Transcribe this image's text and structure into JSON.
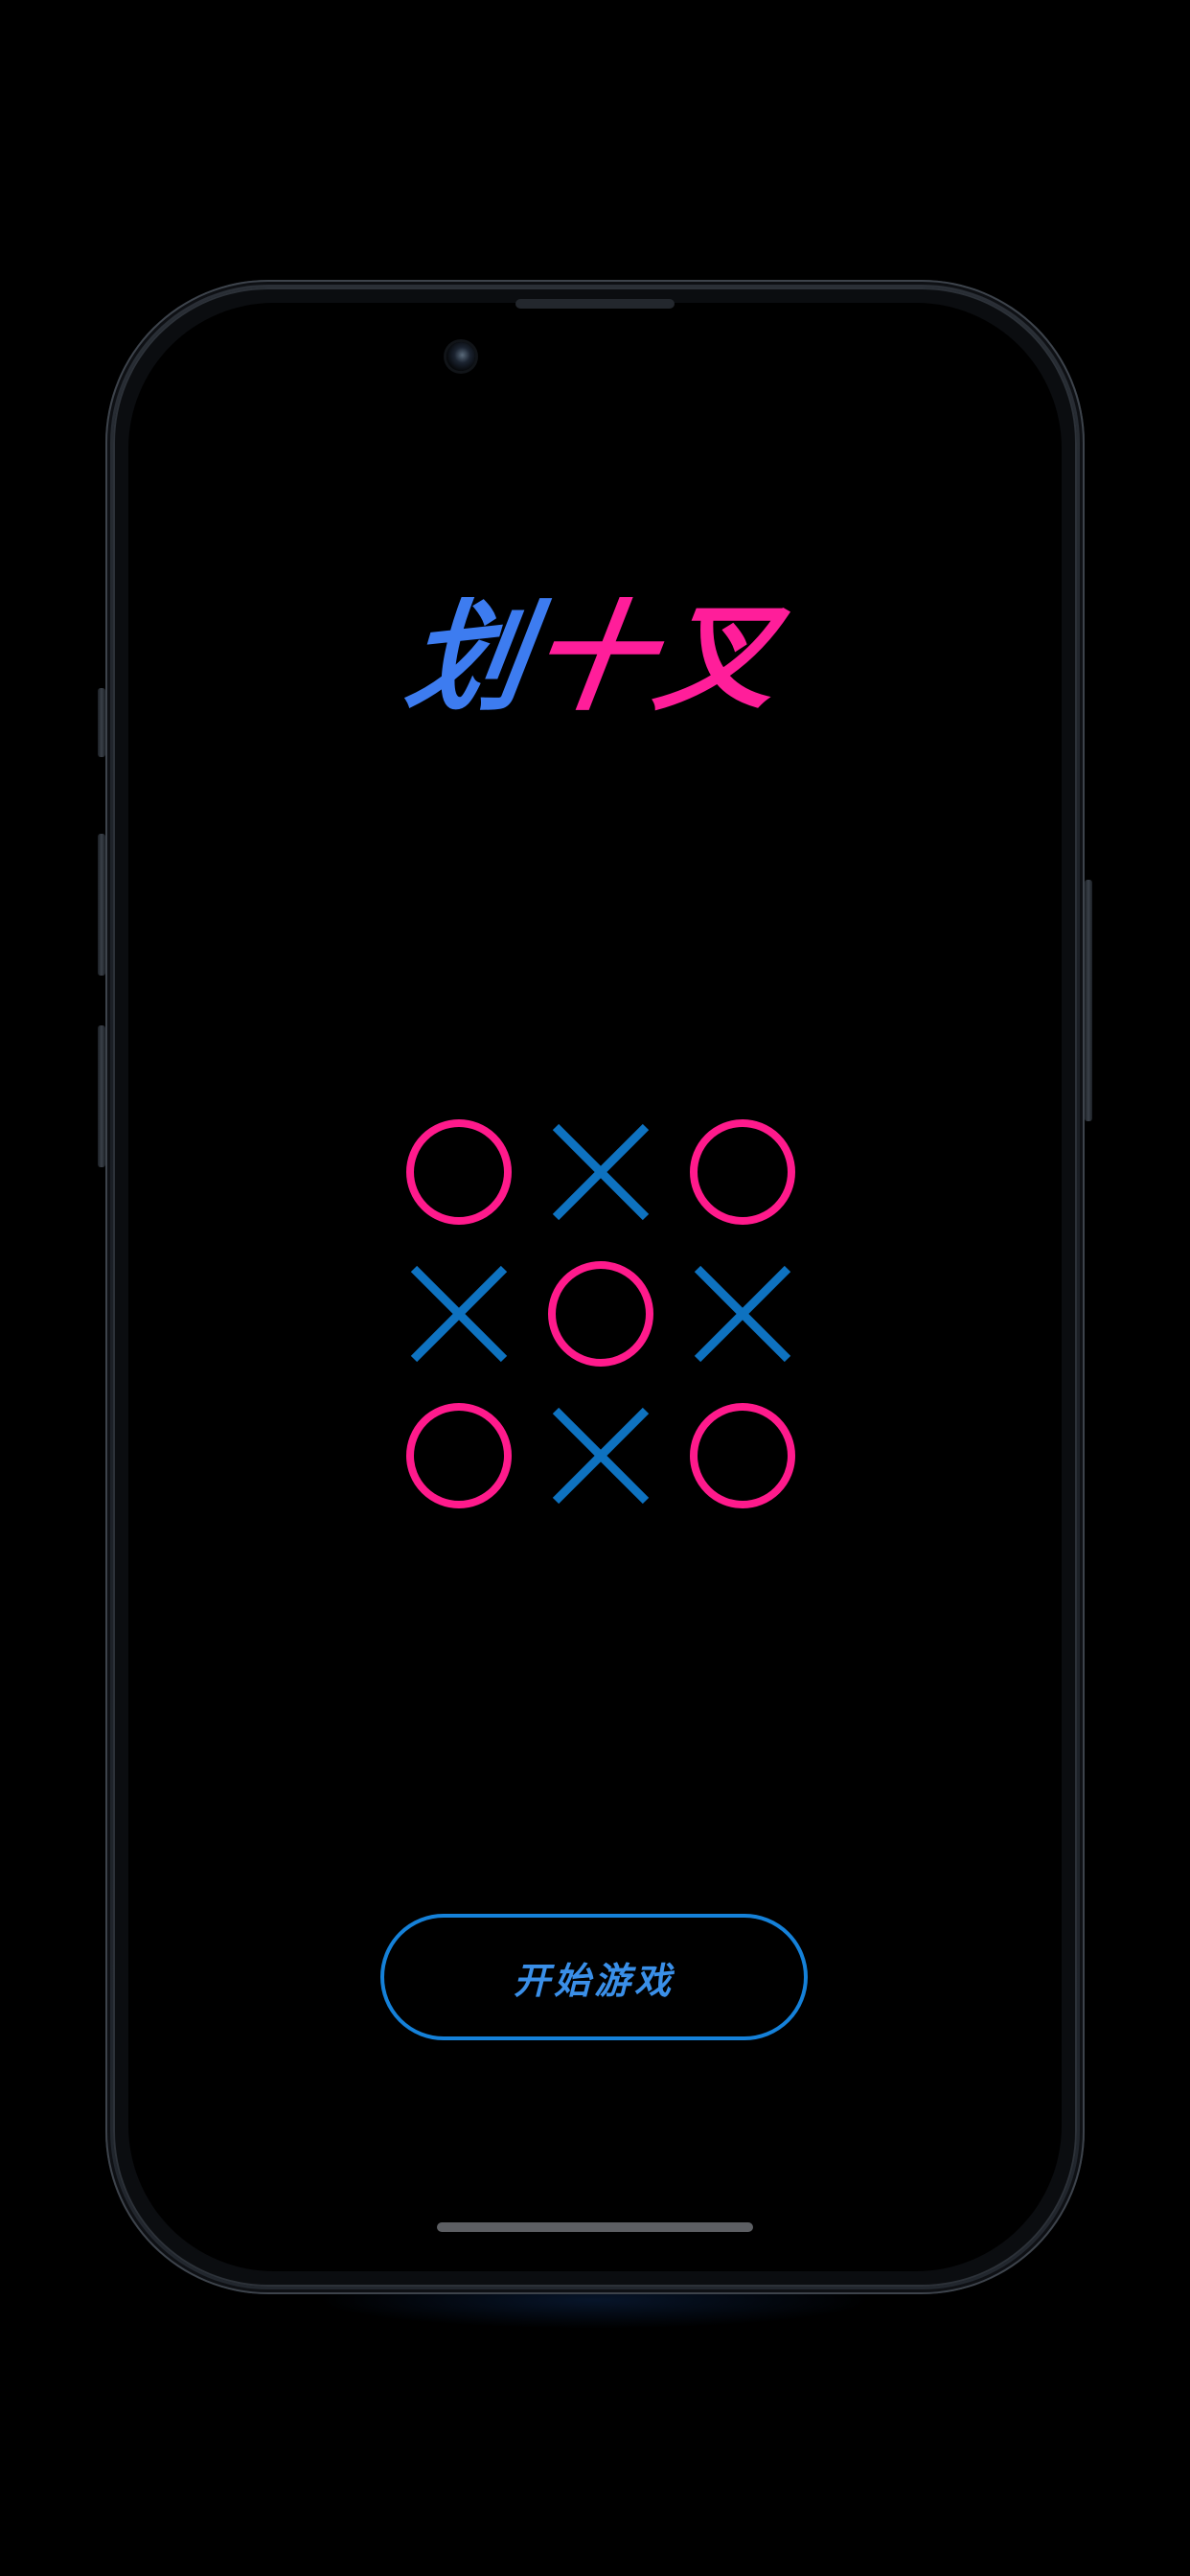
{
  "app": {
    "title_chars": [
      {
        "text": "划",
        "color": "#3d7cf0"
      },
      {
        "text": "十",
        "color": "#ff1e9a"
      },
      {
        "text": "叉",
        "color": "#ff1e9a"
      }
    ]
  },
  "board": {
    "cells": [
      "O",
      "X",
      "O",
      "X",
      "O",
      "X",
      "O",
      "X",
      "O"
    ],
    "o_color": "#ff1a8c",
    "x_color": "#0e72c0"
  },
  "start_button": {
    "label": "开始游戏",
    "border_color": "#1581d9",
    "text_color": "#3a8fe8"
  },
  "icons": {
    "o_mark": "circle-mark-icon",
    "x_mark": "cross-mark-icon",
    "camera": "front-camera-icon"
  }
}
